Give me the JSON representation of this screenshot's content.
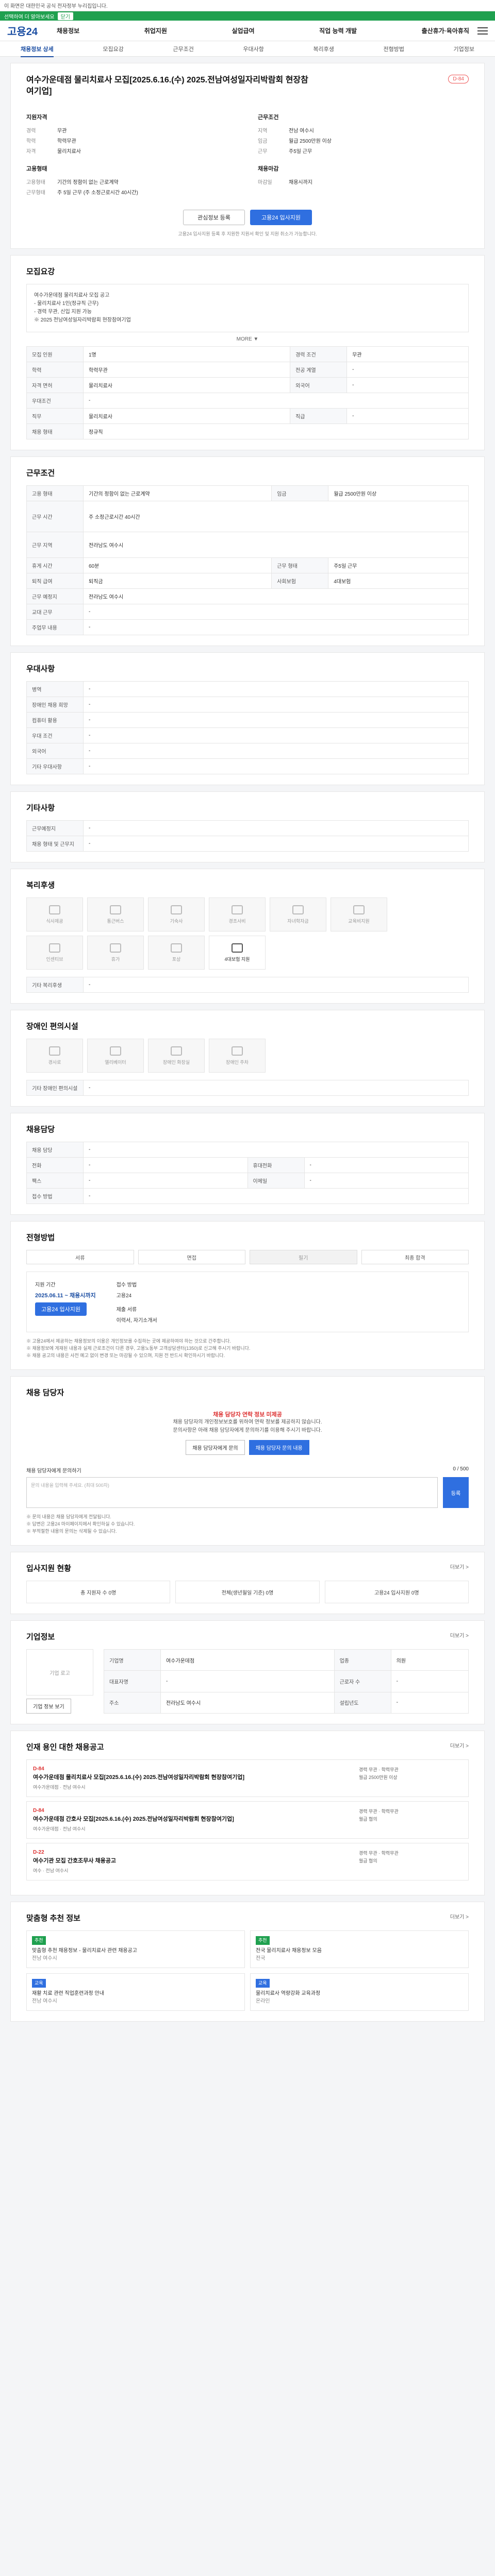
{
  "notice": {
    "text": "이 화면은 대한민국 공식 전자정부 누리집입니다."
  },
  "greenbar": {
    "text": "선택하여 더 알아보세요",
    "btn": "닫기"
  },
  "gnb": {
    "logo": "고용24",
    "menu": [
      "채용정보",
      "취업지원",
      "실업급여",
      "직업 능력 개발",
      "출산휴가·육아휴직"
    ],
    "util": "기업회원"
  },
  "subtabs": {
    "items": [
      "채용정보 상세",
      "모집요강",
      "근무조건",
      "우대사항",
      "복리후생",
      "전형방법",
      "기업정보"
    ]
  },
  "header": {
    "title": "여수가운데점 물리치료사 모집[2025.6.16.(수) 2025.전남여성일자리박람회 현장참여기업]",
    "dday": "D-84",
    "company_title": "지원자격",
    "company_kv": [
      {
        "k": "경력",
        "v": "무관"
      },
      {
        "k": "학력",
        "v": "학력무관"
      },
      {
        "k": "자격",
        "v": "물리치료사"
      }
    ],
    "cond_title": "근무조건",
    "cond_kv": [
      {
        "k": "지역",
        "v": "전남 여수시"
      },
      {
        "k": "임금",
        "v": "월급 2500만원 이상"
      },
      {
        "k": "근무",
        "v": "주5일 근무"
      }
    ],
    "mgr_title": "고용형태",
    "mgr_kv": [
      {
        "k": "고용형태",
        "v": "기간의 정함이 없는 근로계약"
      },
      {
        "k": "근무형태",
        "v": "주 5일 근무 (주 소정근로시간 40시간)"
      }
    ],
    "apply_title": "채용마감",
    "apply_kv": [
      {
        "k": "마감일",
        "v": "채용시까지"
      }
    ],
    "scrap_btn": "관심정보 등록",
    "apply_btn": "고용24 입사지원",
    "note": "고용24 입사지원 등록 후 지원한 지원서 확인 및 지원 취소가 가능합니다."
  },
  "recruit": {
    "title": "모집요강",
    "desc": [
      "여수가운데점 물리치료사 모집 공고",
      "- 물리치료사 1인(정규직 근무)",
      "- 경력 무관, 신입 지원 가능",
      "※ 2025 전남여성일자리박람회 현장참여기업"
    ],
    "more": "MORE ▼",
    "rows": [
      {
        "k": "모집 인원",
        "v": "1명",
        "k2": "경력 조건",
        "v2": "무관"
      },
      {
        "k": "학력",
        "v": "학력무관",
        "k2": "전공 계열",
        "v2": "-"
      },
      {
        "k": "자격 면허",
        "v": "물리치료사",
        "k2": "외국어",
        "v2": "-"
      },
      {
        "k": "우대조건",
        "v": "-",
        "k2": "",
        "v2": ""
      },
      {
        "k": "직무",
        "v": "물리치료사",
        "k2": "직급",
        "v2": "-"
      },
      {
        "k": "채용 형태",
        "v": "정규직",
        "k2": "",
        "v2": ""
      }
    ]
  },
  "work": {
    "title": "근무조건",
    "rows": [
      {
        "k": "고용 형태",
        "v": "기간의 정함이 없는 근로계약",
        "k2": "임금",
        "v2": "월급 2500만원 이상"
      },
      {
        "k": "근무 시간",
        "v": "주 소정근로시간 40시간",
        "k2": "",
        "v2": ""
      },
      {
        "k": "근무 지역",
        "v": "전라남도 여수시",
        "k2": "",
        "v2": ""
      },
      {
        "k": "휴게 시간",
        "v": "60분",
        "k2": "근무 형태",
        "v2": "주5일 근무"
      },
      {
        "k": "퇴직 급여",
        "v": "퇴직금",
        "k2": "사회보험",
        "v2": "4대보험"
      },
      {
        "k": "근무 예정지",
        "v": "전라남도 여수시",
        "k2": "",
        "v2": ""
      },
      {
        "k": "교대 근무",
        "v": "-",
        "k2": "",
        "v2": ""
      },
      {
        "k": "주업무 내용",
        "v": "-",
        "k2": "",
        "v2": ""
      }
    ]
  },
  "prefer": {
    "title": "우대사항",
    "rows": [
      {
        "k": "병역",
        "v": "-"
      },
      {
        "k": "장애인 채용 희망",
        "v": "-"
      },
      {
        "k": "컴퓨터 활용",
        "v": "-"
      },
      {
        "k": "우대 조건",
        "v": "-"
      },
      {
        "k": "외국어",
        "v": "-"
      },
      {
        "k": "기타 우대사항",
        "v": "-"
      }
    ]
  },
  "etc": {
    "title": "기타사항",
    "rows": [
      {
        "k": "근무예정지",
        "v": "-"
      },
      {
        "k": "채용 형태 및 근무지",
        "v": "-"
      }
    ]
  },
  "welfare": {
    "title": "복리후생",
    "icons": [
      "식사제공",
      "통근버스",
      "기숙사",
      "경조사비",
      "자녀학자금",
      "교육비지원",
      "인센티브",
      "휴가",
      "포상",
      "4대보험 지원"
    ],
    "active": "4대보험 지원",
    "etc_label": "기타 복리후생",
    "etc_val": "-"
  },
  "disabled": {
    "title": "장애인 편의시설",
    "icons": [
      "경사로",
      "엘리베이터",
      "장애인 화장실",
      "장애인 주차"
    ],
    "etc_label": "기타 장애인 편의시설",
    "etc_val": "-"
  },
  "manager": {
    "title": "채용담당",
    "rows": [
      {
        "k": "채용 담당",
        "v": "-",
        "k2": "",
        "v2": ""
      },
      {
        "k": "전화",
        "v": "-",
        "k2": "휴대전화",
        "v2": "-"
      },
      {
        "k": "팩스",
        "v": "-",
        "k2": "이메일",
        "v2": "-"
      },
      {
        "k": "접수 방법",
        "v": "-",
        "k2": "",
        "v2": ""
      }
    ]
  },
  "process": {
    "title": "전형방법",
    "steps": [
      "서류",
      "면접",
      "필기",
      "최종 합격"
    ],
    "apply_label": "지원 기간",
    "apply_date": "2025.06.11 ~ 채용시까지",
    "apply_btn": "고용24 입사지원",
    "method_label": "접수 방법",
    "method_val": "고용24",
    "docs_label": "제출 서류",
    "docs_val": "이력서, 자기소개서",
    "warns": [
      "※ 고용24에서 제공하는 채용정보의 이용은 개인정보를 수집하는 곳에 제공하여야 하는 것으로 간주합니다.",
      "※ 채용정보에 게재된 내용과 실제 근로조건이 다른 경우, 고용노동부 고객상담센터(1350)로 신고해 주시기 바랍니다.",
      "※ 채용 공고의 내용은 사전 예고 없이 변경 또는 마감될 수 있으며, 지원 전 반드시 확인하시기 바랍니다."
    ]
  },
  "contact": {
    "title": "채용 담당자",
    "red": "채용 담당자 연락 정보 미제공",
    "desc": [
      "채용 담당자의 개인정보보호를 위하여 연락 정보를 제공하지 않습니다.",
      "문의사항은 아래 채용 담당자에게 문의하기를 이용해 주시기 바랍니다."
    ],
    "btn1": "채용 담당자에게 문의",
    "btn2": "채용 담당자 문의 내용",
    "ta_label": "채용 담당자에게 문의하기",
    "ta_placeholder": "문의 내용을 입력해 주세요. (최대 500자)",
    "ta_count": "0 / 500",
    "ta_btn": "등록",
    "notes": [
      "※ 문의 내용은 채용 담당자에게 전달됩니다.",
      "※ 답변은 고용24 마이페이지에서 확인하실 수 있습니다.",
      "※ 부적절한 내용의 문의는 삭제될 수 있습니다."
    ]
  },
  "stats": {
    "title": "입사지원 현황",
    "more": "더보기 >",
    "items": [
      "총 지원자 수 0명",
      "전체(생년월일 기준) 0명",
      "고용24 입사지원 0명"
    ]
  },
  "company": {
    "title": "기업정보",
    "more": "더보기 >",
    "logo_text": "기업 로고",
    "kv": [
      {
        "k": "기업명",
        "v": "여수가운데점",
        "k2": "업종",
        "v2": "의원"
      },
      {
        "k": "대표자명",
        "v": "-",
        "k2": "근로자 수",
        "v2": "-"
      },
      {
        "k": "주소",
        "v": "전라남도 여수시",
        "k2": "설립년도",
        "v2": "-"
      }
    ],
    "btns": [
      "기업 정보 보기",
      "관심 기업 등록"
    ]
  },
  "related": {
    "title": "인재 용인 대한 채용공고",
    "more": "더보기 >",
    "items": [
      {
        "tag": "D-84",
        "title": "여수가운데점 물리치료사 모집[2025.6.16.(수) 2025.전남여성일자리박람회 현장참여기업]",
        "meta": "여수가운데점 · 전남 여수시",
        "side": "경력 무관 · 학력무관\n월급 2500만원 이상"
      },
      {
        "tag": "D-84",
        "title": "여수가운데점 간호사 모집[2025.6.16.(수) 2025.전남여성일자리박람회 현장참여기업]",
        "meta": "여수가운데점 · 전남 여수시",
        "side": "경력 무관 · 학력무관\n월급 협의"
      },
      {
        "tag": "D-22",
        "title": "여수기관 모집 간호조무사 채용공고",
        "meta": "여수 · 전남 여수시",
        "side": "경력 무관 · 학력무관\n월급 협의"
      }
    ]
  },
  "recommend": {
    "title": "맞춤형 추천 정보",
    "more": "더보기 >",
    "items": [
      {
        "badge": "추천",
        "text": "맞춤형 추천 채용정보 - 물리치료사 관련 채용공고",
        "sub": "전남 여수시"
      },
      {
        "badge": "추천",
        "text": "전국 물리치료사 채용정보 모음",
        "sub": "전국"
      },
      {
        "badge": "교육",
        "text": "재활 치료 관련 직업훈련과정 안내",
        "sub": "전남 여수시"
      },
      {
        "badge": "교육",
        "text": "물리치료사 역량강화 교육과정",
        "sub": "온라인"
      }
    ]
  }
}
